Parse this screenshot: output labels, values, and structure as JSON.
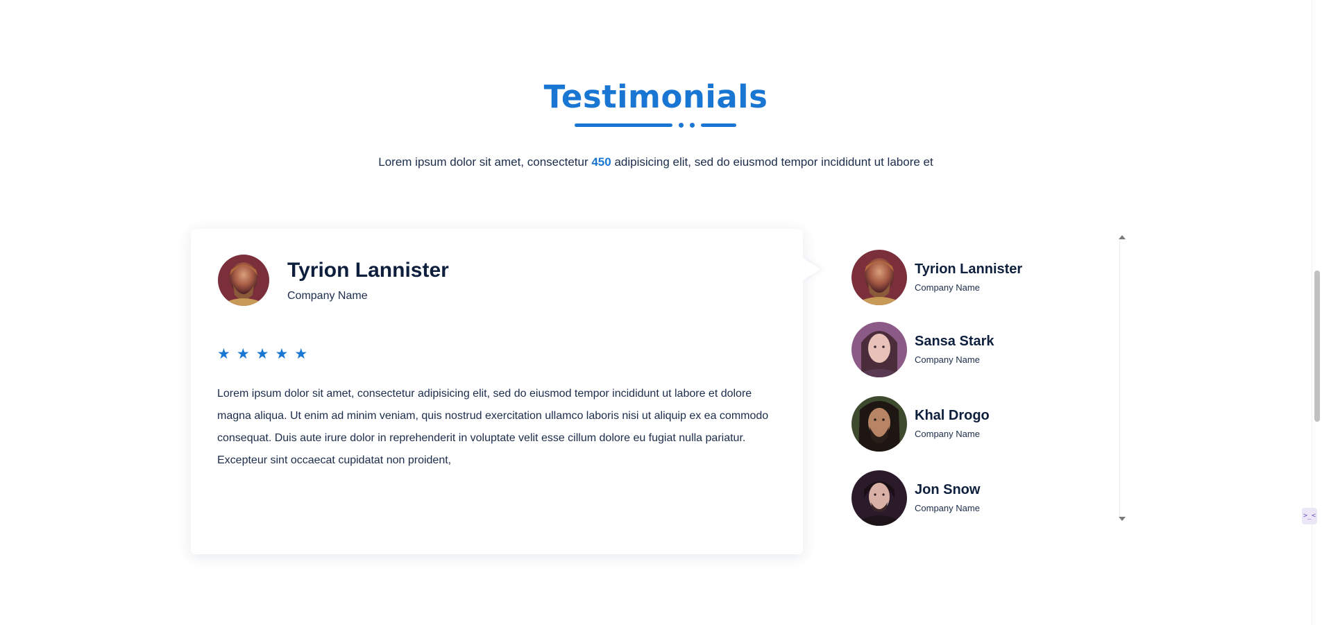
{
  "section": {
    "title": "Testimonials",
    "subtitle_pre": "Lorem ipsum dolor sit amet, consectetur ",
    "subtitle_highlight": "450",
    "subtitle_post": " adipisicing elit, sed do eiusmod tempor incididunt ut labore et",
    "accent_color": "#1976d2"
  },
  "featured": {
    "name": "Tyrion Lannister",
    "company": "Company Name",
    "rating": 5,
    "stars": [
      "★",
      "★",
      "★",
      "★",
      "★"
    ],
    "quote": "Lorem ipsum dolor sit amet, consectetur adipisicing elit, sed do eiusmod tempor incididunt ut labore et dolore magna aliqua. Ut enim ad minim veniam, quis nostrud exercitation ullamco laboris nisi ut aliquip ex ea commodo consequat. Duis aute irure dolor in reprehenderit in voluptate velit esse cillum dolore eu fugiat nulla pariatur. Excepteur sint occaecat cupidatat non proident,"
  },
  "people": [
    {
      "name": "Tyrion Lannister",
      "company": "Company Name"
    },
    {
      "name": "Sansa Stark",
      "company": "Company Name"
    },
    {
      "name": "Khal Drogo",
      "company": "Company Name"
    },
    {
      "name": "Jon Snow",
      "company": "Company Name"
    }
  ],
  "widget": {
    "label": ">_<"
  }
}
